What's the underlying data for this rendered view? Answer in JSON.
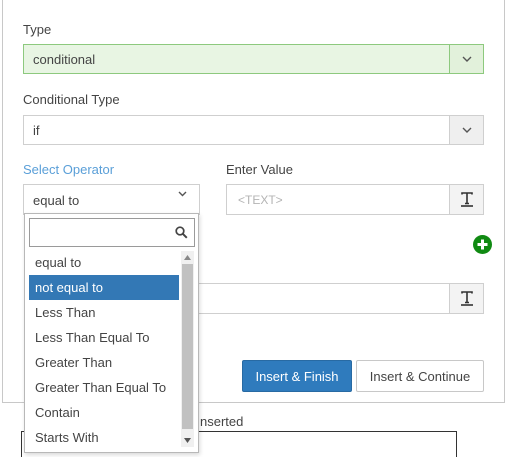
{
  "form": {
    "type_label": "Type",
    "type_value": "conditional",
    "conditional_type_label": "Conditional Type",
    "conditional_type_value": "if",
    "select_operator_label": "Select Operator",
    "operator_value": "equal to",
    "enter_value_label": "Enter Value",
    "enter_value_placeholder": "<TEXT>",
    "inserted_label": "nserted"
  },
  "operator_dropdown": {
    "search_placeholder": "",
    "options": [
      "equal to",
      "not equal to",
      "Less Than",
      "Less Than Equal To",
      "Greater Than",
      "Greater Than Equal To",
      "Contain",
      "Starts With"
    ],
    "highlighted": "not equal to"
  },
  "buttons": {
    "insert_finish": "Insert & Finish",
    "insert_continue": "Insert & Continue"
  },
  "icons": {
    "add": "plus-circle-icon",
    "text_format": "text-format-icon",
    "search": "search-icon",
    "caret": "chevron-down-icon"
  },
  "colors": {
    "accent": "#2f7bbd",
    "selected_option": "#3378b5",
    "type_field_bg": "#e8f5e3",
    "type_field_border": "#8dc97e",
    "add_icon": "#108a12",
    "label_blue": "#5a9fd8"
  }
}
